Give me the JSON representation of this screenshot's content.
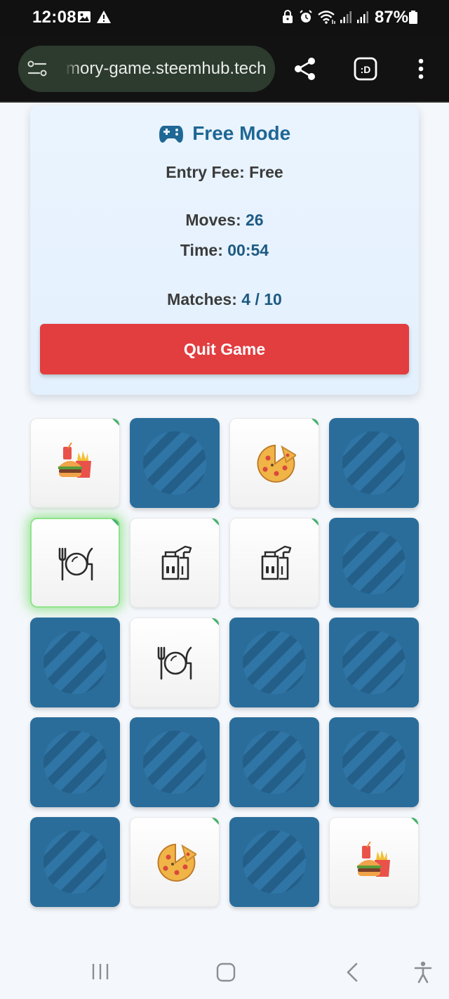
{
  "status_bar": {
    "time": "12:08",
    "battery": "87%"
  },
  "browser": {
    "url": "mory-game.steemhub.tech"
  },
  "game": {
    "mode_title": "Free Mode",
    "entry_fee_label": "Entry Fee:",
    "entry_fee_value": "Free",
    "moves_label": "Moves:",
    "moves_value": "26",
    "time_label": "Time:",
    "time_value": "00:54",
    "matches_label": "Matches:",
    "matches_value": "4 / 10",
    "quit_button_label": "Quit Game"
  },
  "grid": {
    "cards": [
      {
        "state": "face",
        "icon": "burger-combo-icon",
        "matched": true
      },
      {
        "state": "back"
      },
      {
        "state": "face",
        "icon": "pizza-icon",
        "matched": true
      },
      {
        "state": "back"
      },
      {
        "state": "face",
        "icon": "plate-cutlery-icon",
        "matched": true,
        "highlight": true
      },
      {
        "state": "face",
        "icon": "takeaway-bag-icon",
        "matched": true
      },
      {
        "state": "face",
        "icon": "takeaway-bag-icon",
        "matched": true
      },
      {
        "state": "back"
      },
      {
        "state": "back"
      },
      {
        "state": "face",
        "icon": "plate-cutlery-icon",
        "matched": true
      },
      {
        "state": "back"
      },
      {
        "state": "back"
      },
      {
        "state": "back"
      },
      {
        "state": "back"
      },
      {
        "state": "back"
      },
      {
        "state": "back"
      },
      {
        "state": "back"
      },
      {
        "state": "face",
        "icon": "pizza-icon",
        "matched": true
      },
      {
        "state": "back"
      },
      {
        "state": "face",
        "icon": "burger-combo-icon",
        "matched": true
      }
    ]
  },
  "colors": {
    "accent_blue": "#1f6794",
    "card_back": "#2a6d9b",
    "quit_red": "#e23d3f",
    "match_green": "#43b06a"
  }
}
